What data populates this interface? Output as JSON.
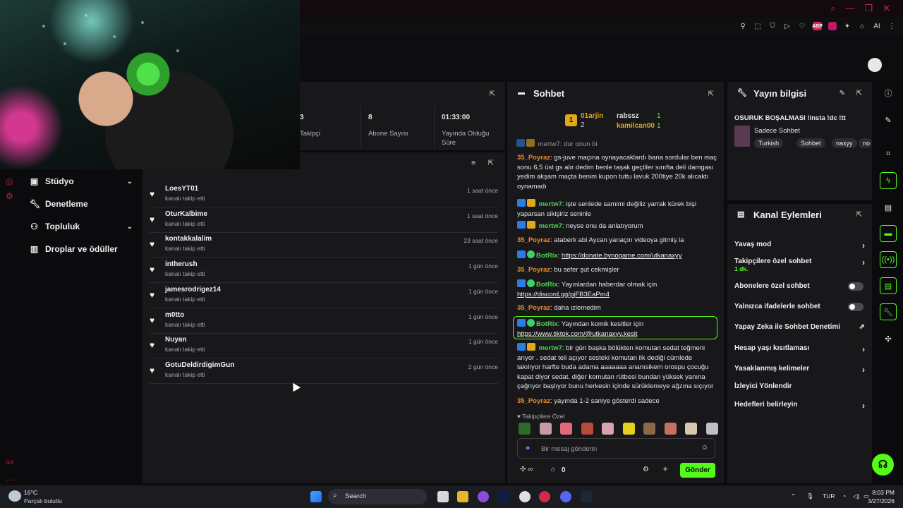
{
  "colors": {
    "brand_green": "#53fc18",
    "accent_red": "#c8284a",
    "panel_bg": "#18181b",
    "page_bg": "#0b0b0d"
  },
  "sidebar": {
    "items": [
      {
        "label": "Stüdyo",
        "icon": "studio-icon"
      },
      {
        "label": "Denetleme",
        "icon": "wrench-icon"
      },
      {
        "label": "Topluluk",
        "icon": "community-icon"
      },
      {
        "label": "Droplar ve ödüller",
        "icon": "drops-icon"
      }
    ],
    "footer_text": "GX"
  },
  "stats": [
    {
      "num": "3",
      "label": "Takipçi"
    },
    {
      "num": "8",
      "label": "Abone Sayısı"
    },
    {
      "num": "01:33:00",
      "label": "Yayında Olduğu Süre"
    }
  ],
  "activity": [
    {
      "name": "LoesYT01",
      "sub": "kanalı takip etti",
      "time": "1 saat önce"
    },
    {
      "name": "OturKalbime",
      "sub": "kanalı takip etti",
      "time": "1 saat önce"
    },
    {
      "name": "kontakkalalim",
      "sub": "kanalı takip etti",
      "time": "23 saat önce"
    },
    {
      "name": "intherush",
      "sub": "kanalı takip etti",
      "time": "1 gün önce"
    },
    {
      "name": "jamesrodrigez14",
      "sub": "kanalı takip etti",
      "time": "1 gün önce"
    },
    {
      "name": "m0tto",
      "sub": "kanalı takip etti",
      "time": "1 gün önce"
    },
    {
      "name": "Nuyan",
      "sub": "kanalı takip etti",
      "time": "1 gün önce"
    },
    {
      "name": "GotuDeldirdigimGun",
      "sub": "kanalı takip etti",
      "time": "2 gün önce"
    }
  ],
  "chat": {
    "title": "Sohbet",
    "leaderboard": {
      "first_rank": "1",
      "first": "01arjin",
      "second": "rabssz",
      "third": "kamilcan00",
      "second_rank_num": "2",
      "count_a": "1",
      "count_b": "1"
    },
    "cut_off": "mertw7: dur onun bi",
    "messages": [
      {
        "user": "35_Poyraz",
        "color": "orange",
        "text": ": gs-juve maçına oynayacaklardı bana sordular ben maç sonu 6,5 üst gs alır dedim benle taşak geçtiler sınıfta deli damgası yedim akşam maçta benim kupon tuttu lavuk 200tiye 20k alıcaktı oynamadı"
      },
      {
        "user": "mertw7",
        "color": "green",
        "text": ": işte senlede samimi değiliz yarrak kürek bişi yaparsan sikişiriz seninle"
      },
      {
        "user": "mertw7",
        "color": "green",
        "text": ": neyse onu da anlatıyorum"
      },
      {
        "user": "35_Poyraz",
        "color": "orange",
        "text": ": ataberk abi Aycan yanaçın videoya gitmiş la"
      },
      {
        "user": "BotRix",
        "color": "green",
        "text": ": ",
        "link": "https://donate.bynogame.com/utkanaxyy"
      },
      {
        "user": "35_Poyraz",
        "color": "orange",
        "text": ": bu sefer şut cekmişler"
      },
      {
        "user": "BotRix",
        "color": "green",
        "text": ": Yayınlardan haberdar olmak için ",
        "link": "https://discord.gg/pjFB3EaPm4"
      },
      {
        "user": "35_Poyraz",
        "color": "orange",
        "text": ": daha izlemedim"
      },
      {
        "user": "BotRix",
        "color": "green",
        "text": ": Yayından komik kesitler için ",
        "link": "https://www.tiktok.com/@utkanaxyy.kesit"
      },
      {
        "user": "mertw7",
        "color": "green",
        "text": ": bir gün başka bölükten komutan sedat teğmeni arıyor . sedat teli açıyor sesteki komutan ilk dediği cümlede takılıyor harfte buda adama aaaaaaa ananısikem orospu çocuğu kapat diyor sedat. diğer komutan rütbesi bundan yüksek yanına çağrıyor başlıyor bunu herkesin içinde sürüklemeye ağzına sıçıyor"
      },
      {
        "user": "35_Poyraz",
        "color": "orange",
        "text": ": yayında 1-2 saniye gösterdi sadece"
      }
    ],
    "emote_label": "Takipçilere Özel",
    "input_placeholder": "Bir mesaj gönderin",
    "points": "0",
    "send_label": "Gönder"
  },
  "info": {
    "title": "Yayın bilgisi",
    "stream_title": "OSURUK BOŞALMASI !insta !dc !tt",
    "category": "Sadece Sohbet",
    "tags": [
      "Turkish",
      "Sohbet",
      "naxyy",
      "no"
    ]
  },
  "actions": {
    "title": "Kanal Eylemleri",
    "items": [
      {
        "label": "Yavaş mod",
        "control": "chevron"
      },
      {
        "label": "Takipçilere özel sohbet",
        "sub": "1 dk.",
        "control": "chevron"
      },
      {
        "label": "Abonelere özel sohbet",
        "control": "toggle"
      },
      {
        "label": "Yalnızca ifadelerle sohbet",
        "control": "toggle"
      },
      {
        "label": "Yapay Zeka ile Sohbet Denetimi",
        "control": "external"
      },
      {
        "label": "Hesap yaşı kısıtlaması",
        "control": "chevron"
      },
      {
        "label": "Yasaklanmış kelimeler",
        "control": "chevron"
      },
      {
        "label": "İzleyici Yönlendir",
        "control": "none"
      },
      {
        "label": "Hedefleri belirleyin",
        "control": "chevron"
      }
    ]
  },
  "taskbar": {
    "temp": "16°C",
    "weather": "Parçalı bulutlu",
    "search": "Search",
    "lang": "TUR",
    "time": "8:03 PM",
    "date": "3/27/2026"
  }
}
